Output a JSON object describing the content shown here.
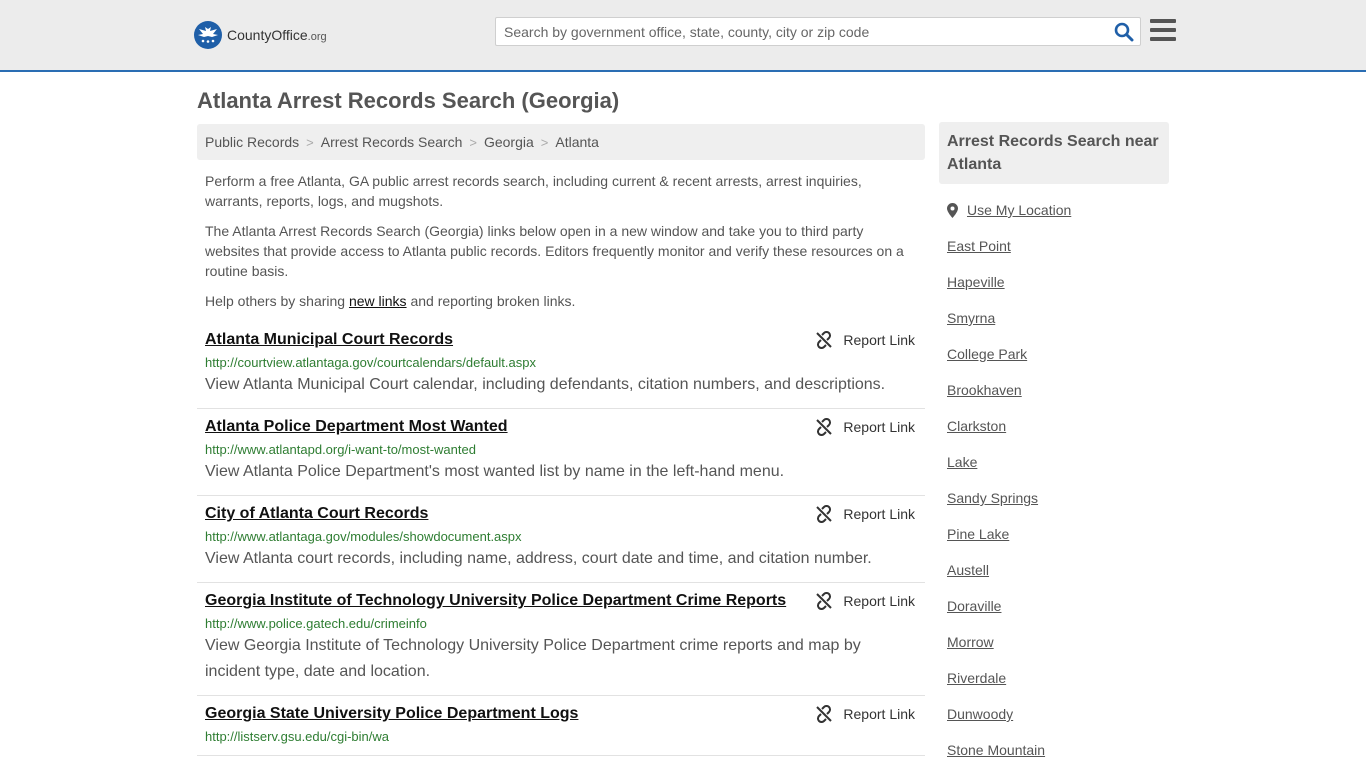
{
  "header": {
    "logo_name": "CountyOffice",
    "logo_suffix": ".org",
    "search_placeholder": "Search by government office, state, county, city or zip code",
    "brand_color": "#1f5fa8"
  },
  "page_title": "Atlanta Arrest Records Search (Georgia)",
  "breadcrumb": [
    "Public Records",
    "Arrest Records Search",
    "Georgia",
    "Atlanta"
  ],
  "intro": {
    "p1": "Perform a free Atlanta, GA public arrest records search, including current & recent arrests, arrest inquiries, warrants, reports, logs, and mugshots.",
    "p2": "The Atlanta Arrest Records Search (Georgia) links below open in a new window and take you to third party websites that provide access to Atlanta public records. Editors frequently monitor and verify these resources on a routine basis.",
    "p3_before": "Help others by sharing ",
    "p3_link": "new links",
    "p3_after": " and reporting broken links."
  },
  "report_label": "Report Link",
  "records": [
    {
      "title": "Atlanta Municipal Court Records",
      "url": "http://courtview.atlantaga.gov/courtcalendars/default.aspx",
      "desc": "View Atlanta Municipal Court calendar, including defendants, citation numbers, and descriptions."
    },
    {
      "title": "Atlanta Police Department Most Wanted",
      "url": "http://www.atlantapd.org/i-want-to/most-wanted",
      "desc": "View Atlanta Police Department's most wanted list by name in the left-hand menu."
    },
    {
      "title": "City of Atlanta Court Records",
      "url": "http://www.atlantaga.gov/modules/showdocument.aspx",
      "desc": "View Atlanta court records, including name, address, court date and time, and citation number."
    },
    {
      "title": "Georgia Institute of Technology University Police Department Crime Reports",
      "url": "http://www.police.gatech.edu/crimeinfo",
      "desc": "View Georgia Institute of Technology University Police Department crime reports and map by incident type, date and location."
    },
    {
      "title": "Georgia State University Police Department Logs",
      "url": "http://listserv.gsu.edu/cgi-bin/wa",
      "desc": ""
    }
  ],
  "sidebar": {
    "heading": "Arrest Records Search near Atlanta",
    "use_location": "Use My Location",
    "nearby": [
      "East Point",
      "Hapeville",
      "Smyrna",
      "College Park",
      "Brookhaven",
      "Clarkston",
      "Lake",
      "Sandy Springs",
      "Pine Lake",
      "Austell",
      "Doraville",
      "Morrow",
      "Riverdale",
      "Dunwoody",
      "Stone Mountain"
    ]
  }
}
